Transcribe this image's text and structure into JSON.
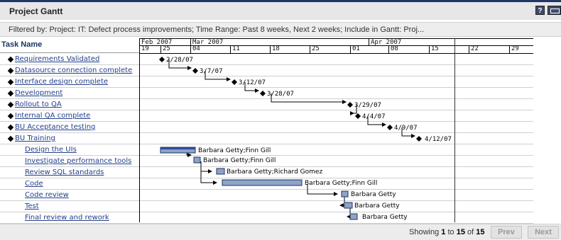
{
  "portlet": {
    "title": "Project Gantt",
    "help_icon": "?",
    "export_icon": "export-icon",
    "filter_text": "Filtered by: Project: IT: Defect process improvements; Time Range: Past 8 weeks, Next 2 weeks; Include in Gantt: Proj..."
  },
  "grid": {
    "task_header": "Task Name",
    "months": [
      {
        "label": "Feb 2007"
      },
      {
        "label": "Mar 2007"
      },
      {
        "label": "Apr 2007"
      }
    ],
    "weeks": [
      "19",
      "25",
      "04",
      "11",
      "18",
      "25",
      "01",
      "08",
      "15",
      "22",
      "29"
    ]
  },
  "tasks": [
    {
      "name": "Requirements Validated",
      "milestone": true,
      "label": "2/28/07"
    },
    {
      "name": "Datasource connection complete",
      "milestone": true,
      "label": "3/7/07"
    },
    {
      "name": "Interface design complete",
      "milestone": true,
      "label": "3/12/07"
    },
    {
      "name": "Development",
      "milestone": true,
      "label": "3/28/07"
    },
    {
      "name": "Rollout to QA",
      "milestone": true,
      "label": "3/29/07"
    },
    {
      "name": "Internal QA complete",
      "milestone": true,
      "label": "4/4/07"
    },
    {
      "name": "BU Acceptance testing",
      "milestone": true,
      "label": "4/9/07"
    },
    {
      "name": "BU Training",
      "milestone": true,
      "label": "4/12/07"
    },
    {
      "name": "Design the UIs",
      "milestone": false,
      "label": "Barbara Getty;Finn Gill"
    },
    {
      "name": "Investigate performance tools",
      "milestone": false,
      "label": "Barbara Getty;Finn Gill"
    },
    {
      "name": "Review SQL standards",
      "milestone": false,
      "label": "Barbara Getty;Richard Gomez"
    },
    {
      "name": "Code",
      "milestone": false,
      "label": "Barbara Getty;Finn Gill"
    },
    {
      "name": "Code review",
      "milestone": false,
      "label": "Barbara Getty"
    },
    {
      "name": "Test",
      "milestone": false,
      "label": "Barbara Getty"
    },
    {
      "name": "Final review and rework",
      "milestone": false,
      "label": "Barbara Getty"
    }
  ],
  "footer": {
    "showing_prefix": "Showing",
    "range_start": "1",
    "to_word": "to",
    "range_end": "15",
    "of_word": "of",
    "total": "15",
    "prev_label": "Prev",
    "next_label": "Next"
  },
  "colors": {
    "header_accent": "#1f3666",
    "link": "#24408a",
    "bar_fill": "#8fa2c8",
    "bar_progress": "#2a4a9a"
  }
}
